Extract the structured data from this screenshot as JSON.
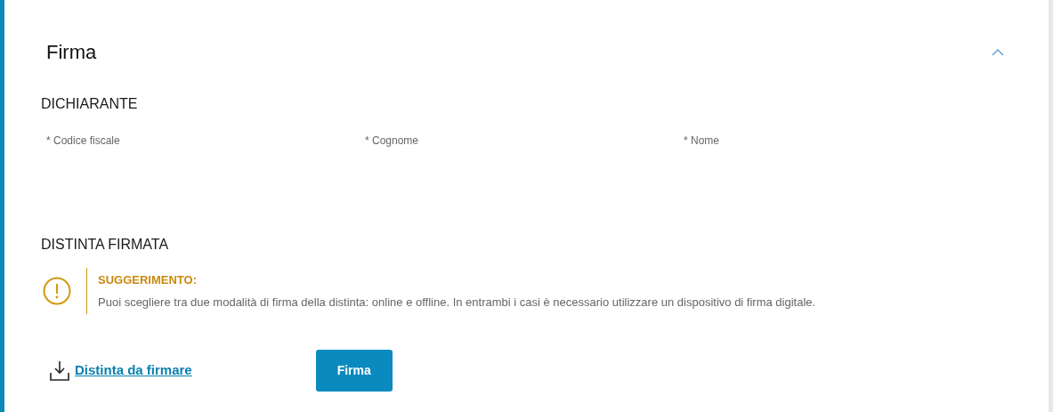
{
  "panel": {
    "title": "Firma",
    "expanded": true
  },
  "sections": [
    {
      "title": "DICHIARANTE",
      "fields": [
        {
          "label": "* Codice fiscale"
        },
        {
          "label": "* Cognome"
        },
        {
          "label": "* Nome"
        }
      ]
    },
    {
      "title": "DISTINTA FIRMATA",
      "callout": {
        "title": "SUGGERIMENTO:",
        "text": "Puoi scegliere tra due modalità di firma della distinta: online e offline. In entrambi i casi è necessario utilizzare un dispositivo di firma digitale."
      },
      "download_link": "Distinta da firmare",
      "button": "Firma"
    }
  ]
}
